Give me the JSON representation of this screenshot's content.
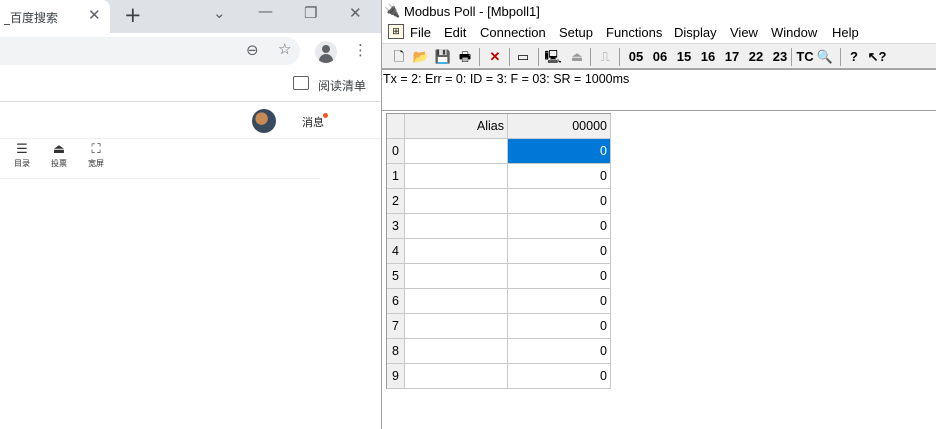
{
  "chrome": {
    "tab_title": "_百度搜索",
    "tab_close": "✕",
    "new_tab": "+",
    "reading_list": "阅读清单",
    "message": "消息",
    "doc_tools": [
      {
        "icon": "☰",
        "label": "目录"
      },
      {
        "icon": "⏏",
        "label": "投票"
      },
      {
        "icon": "⛶",
        "label": "宽屏"
      }
    ]
  },
  "modbus": {
    "app_icon": "🔌",
    "title": "Modbus Poll - [Mbpoll1]",
    "menu": [
      "File",
      "Edit",
      "Connection",
      "Setup",
      "Functions",
      "Display",
      "View",
      "Window",
      "Help"
    ],
    "function_codes": [
      "05",
      "06",
      "15",
      "16",
      "17",
      "22",
      "23"
    ],
    "tc_label": "TC",
    "status_line": "Tx = 2: Err = 0: ID = 3: F = 03: SR = 1000ms",
    "grid": {
      "alias_header": "Alias",
      "value_header": "00000",
      "selected_row": 0,
      "rows": [
        {
          "index": "0",
          "alias": "",
          "value": "0"
        },
        {
          "index": "1",
          "alias": "",
          "value": "0"
        },
        {
          "index": "2",
          "alias": "",
          "value": "0"
        },
        {
          "index": "3",
          "alias": "",
          "value": "0"
        },
        {
          "index": "4",
          "alias": "",
          "value": "0"
        },
        {
          "index": "5",
          "alias": "",
          "value": "0"
        },
        {
          "index": "6",
          "alias": "",
          "value": "0"
        },
        {
          "index": "7",
          "alias": "",
          "value": "0"
        },
        {
          "index": "8",
          "alias": "",
          "value": "0"
        },
        {
          "index": "9",
          "alias": "",
          "value": "0"
        }
      ]
    }
  }
}
